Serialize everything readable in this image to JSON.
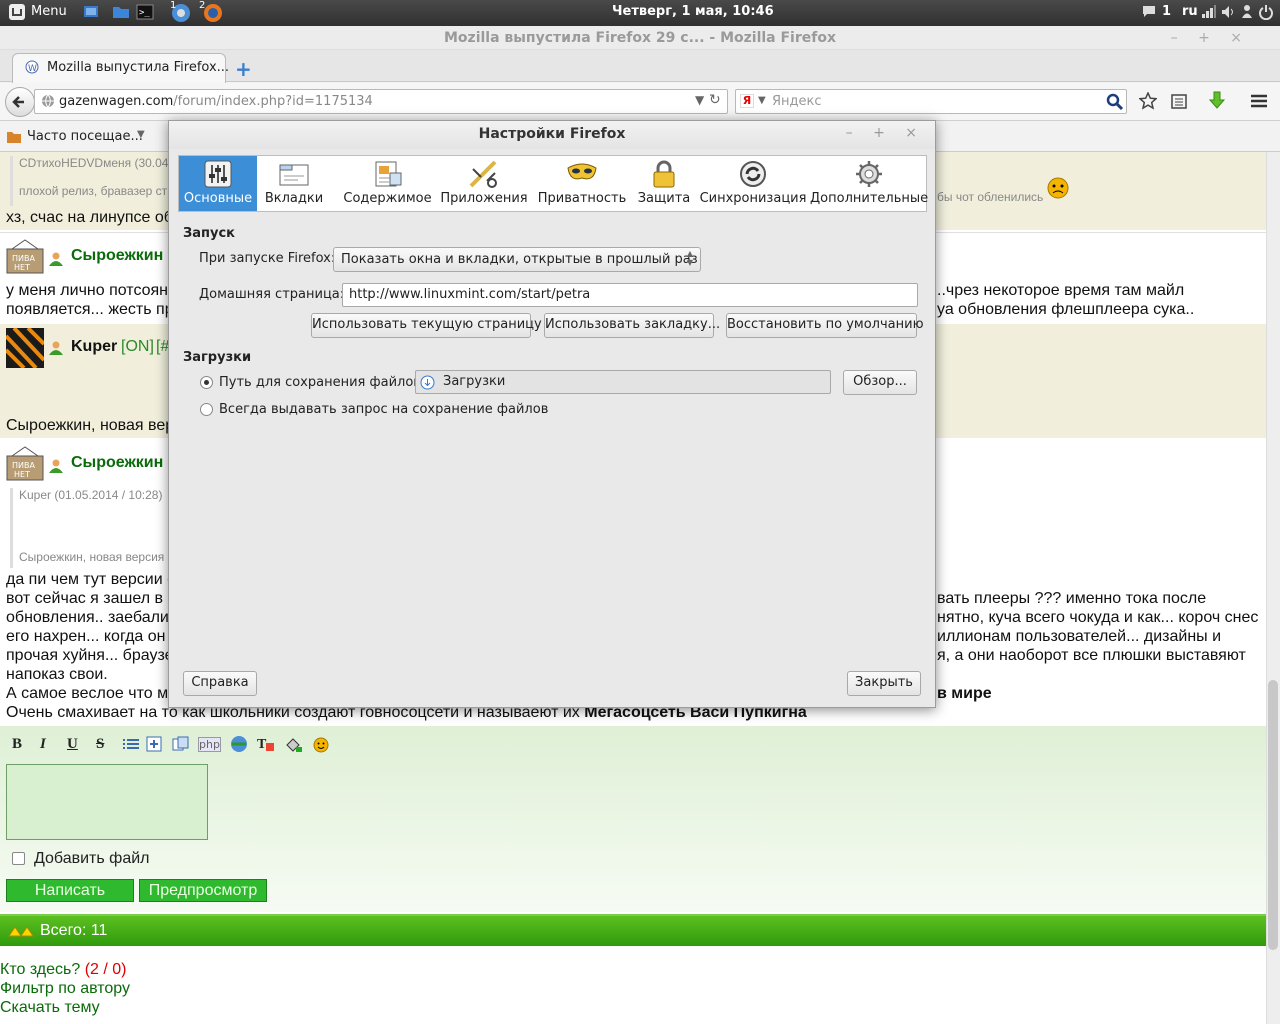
{
  "panel": {
    "menu_label": "Menu",
    "clock": "Четверг,  1 мая, 10:46",
    "msg_count": "1",
    "lang": "ru",
    "ws1": "1",
    "ws2": "2"
  },
  "window": {
    "title": "Mozilla выпустила Firefox 29 с... - Mozilla Firefox",
    "controls": "– + ×"
  },
  "tab": {
    "title": "Mozilla выпустила Firefox...",
    "close": "×",
    "new": "+"
  },
  "nav": {
    "url_host": "gazenwagen.com",
    "url_path": "/forum/index.php?id=1175134",
    "search_placeholder": "Яндекс",
    "search_engine_icon": "Я"
  },
  "bookmarks": {
    "item": "Часто посещае..."
  },
  "forum": {
    "post1_quote_head": "CDтихоHEDVDменя (30.04",
    "post1_quote": "плохой релиз, бравазер ст",
    "post1_quote_right": "бы чот обленились",
    "post1_text": "хз, счас на линупсе об",
    "post2_nick": "Сыроежкин",
    "post2_text1": "у меня лично потсоян",
    "post2_text1r": "..чрез некоторое время там майл",
    "post2_text2": "появляется... жесть пр",
    "post2_text2r": "уа обновления флешплеера сука..",
    "post3_nick": "Kuper",
    "post3_status": "[ON]",
    "post3_status2": "[#",
    "post3_text": "Сыроежкин, новая вер",
    "post4_nick": "Сыроежкин",
    "post4_quote_head": "Kuper (01.05.2014 / 10:28)",
    "post4_quote": "Сыроежкин, новая версия",
    "post4_l1": "да пи чем тут версии е",
    "post4_l2": "вот сейчас я зашел в с",
    "post4_l2r": "вать плееры ??? именно тока после",
    "post4_l3": "обновления.. заебали",
    "post4_l3r": "нятно, куча всего чокуда и как... короч снес",
    "post4_l4": "его нахрен... когда он",
    "post4_l4r": "иллионам пользователей... дизайны и",
    "post4_l5": "прочая хуйня... браузе",
    "post4_l5r": "я, а они наоборот все плюшки выставяют",
    "post4_l6": "напоказ свои.",
    "post4_l7": "А самое веслое что м",
    "post4_l7r": "в мире",
    "post4_l8a": "Очень смахивает на то как школьники создают говносоцсети и называеют их ",
    "post4_l8b": "Мегасоцсеть Васи Пупкигна"
  },
  "editor": {
    "bold": "B",
    "italic": "I",
    "underline": "U",
    "strike": "S",
    "php": "php",
    "attach_label": "Добавить файл",
    "submit": "Написать",
    "preview": "Предпросмотр",
    "total": "Всего: 11",
    "who_here": "Кто здесь?",
    "who_count": "(2 / 0)",
    "filter": "Фильтр по автору",
    "download": "Скачать тему"
  },
  "dialog": {
    "title": "Настройки Firefox",
    "controls": "– + ×",
    "tabs": [
      {
        "label": "Основные",
        "icon": "general-icon"
      },
      {
        "label": "Вкладки",
        "icon": "tabs-icon"
      },
      {
        "label": "Содержимое",
        "icon": "content-icon"
      },
      {
        "label": "Приложения",
        "icon": "applications-icon"
      },
      {
        "label": "Приватность",
        "icon": "privacy-mask-icon"
      },
      {
        "label": "Защита",
        "icon": "lock-icon"
      },
      {
        "label": "Синхронизация",
        "icon": "sync-icon"
      },
      {
        "label": "Дополнительные",
        "icon": "gear-icon"
      }
    ],
    "startup_header": "Запуск",
    "startup_label": "При запуске Firefox:",
    "startup_value": "Показать окна и вкладки, открытые в прошлый раз",
    "home_label": "Домашняя страница:",
    "home_value": "http://www.linuxmint.com/start/petra",
    "use_current": "Использовать текущую страницу",
    "use_bookmark": "Использовать закладку...",
    "restore_default": "Восстановить по умолчанию",
    "downloads_header": "Загрузки",
    "save_path_label": "Путь для сохранения файлов",
    "save_path_value": "Загрузки",
    "browse": "Обзор...",
    "always_ask": "Всегда выдавать запрос на сохранение файлов",
    "help": "Справка",
    "close": "Закрыть"
  },
  "colors": {
    "accent": "#3c8fd6",
    "forum_green": "#0a6b0a",
    "submit_bg": "#2fb92f",
    "bar_green": "#3aa512"
  }
}
